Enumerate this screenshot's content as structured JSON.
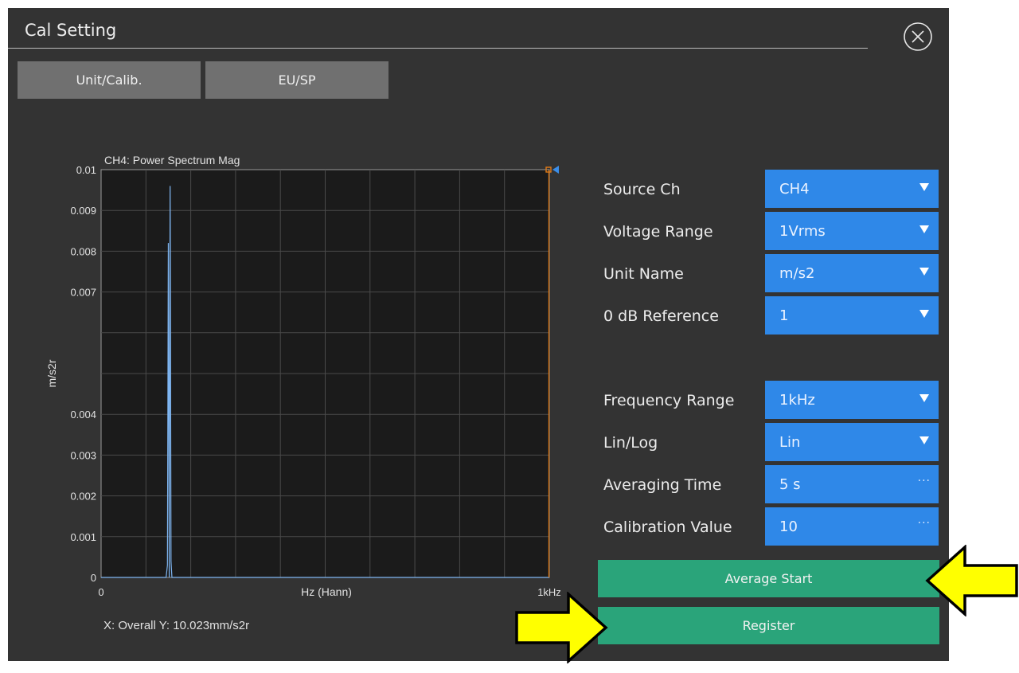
{
  "window": {
    "title": "Cal Setting"
  },
  "icons": {
    "close": "close-circle-icon",
    "arrow": "yellow-arrow-icon",
    "dropdown": "dropdown-triangle-icon",
    "more": "ellipsis-icon"
  },
  "tabs": [
    {
      "label": "Unit/Calib."
    },
    {
      "label": "EU/SP"
    }
  ],
  "controls": [
    {
      "label": "Source Ch",
      "value": "CH4",
      "kind": "dropdown"
    },
    {
      "label": "Voltage Range",
      "value": "1Vrms",
      "kind": "dropdown"
    },
    {
      "label": "Unit Name",
      "value": "m/s2",
      "kind": "dropdown"
    },
    {
      "label": "0 dB Reference",
      "value": "1",
      "kind": "dropdown"
    },
    {
      "label": "Frequency Range",
      "value": "1kHz",
      "kind": "dropdown"
    },
    {
      "label": "Lin/Log",
      "value": "Lin",
      "kind": "dropdown"
    },
    {
      "label": "Averaging Time",
      "value": "5 s",
      "kind": "ellipsis"
    },
    {
      "label": "Calibration Value",
      "value": "10",
      "kind": "ellipsis"
    }
  ],
  "buttons": {
    "average_start": "Average Start",
    "register": "Register"
  },
  "chart_data": {
    "type": "line",
    "title": "CH4: Power Spectrum Mag",
    "xlabel": "Hz (Hann)",
    "ylabel": "m/s2r",
    "x_tick_labels": [
      "0",
      "1kHz"
    ],
    "y_tick_labels": [
      "0",
      "0.001",
      "0.002",
      "0.003",
      "0.004",
      "0.007",
      "0.008",
      "0.009",
      "0.01"
    ],
    "ylim": [
      0,
      0.01
    ],
    "xlim": [
      0,
      1000
    ],
    "grid": true,
    "series": [
      {
        "x": [
          0,
          145,
          148,
          150,
          152,
          154,
          156,
          158,
          160,
          1000
        ],
        "values": [
          0,
          0,
          0.0003,
          0.0082,
          0.0,
          0.0096,
          0.0004,
          0,
          0,
          0
        ]
      }
    ],
    "cursor_x": 1000,
    "readout": "X: Overall Y: 10.023mm/s2r",
    "colors": {
      "trace": "#7fb6f2",
      "cursor": "#e07a17",
      "plot_bg": "#1b1b1b",
      "grid": "#4a4a4a"
    }
  },
  "colors": {
    "accent_blue": "#2f88e8",
    "accent_green": "#2aa47a",
    "arrow_yellow": "#ffff00"
  }
}
